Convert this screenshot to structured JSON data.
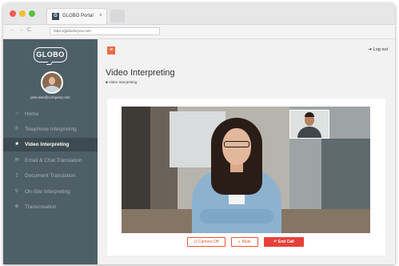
{
  "browser": {
    "tab_favicon": "G",
    "tab_title": "GLOBO Portal",
    "tab_close": "×",
    "nav_buttons": "← → C",
    "url": "https://globoforyou.com"
  },
  "sidebar": {
    "logo": "GLOBO",
    "user_email": "jane.doe@company.com",
    "items": [
      {
        "icon": "home-icon",
        "glyph": "⌂",
        "label": "Home"
      },
      {
        "icon": "phone-icon",
        "glyph": "✆",
        "label": "Telephone Interpreting"
      },
      {
        "icon": "video-camera-icon",
        "glyph": "■",
        "label": "Video Interpreting"
      },
      {
        "icon": "email-icon",
        "glyph": "✉",
        "label": "Email & Chat Translation"
      },
      {
        "icon": "document-icon",
        "glyph": "▯",
        "label": "Document Translation"
      },
      {
        "icon": "location-icon",
        "glyph": "⚲",
        "label": "On-Site Interpreting"
      },
      {
        "icon": "globe-icon",
        "glyph": "⊕",
        "label": "Transcreation"
      }
    ],
    "active_index": 2
  },
  "header": {
    "menu_glyph": "≡",
    "logout_label": "➜ Log out"
  },
  "main": {
    "page_title": "Video Interpreting",
    "breadcrumb": "■ Video Interpreting"
  },
  "controls": {
    "camera_label": "⊡ Camera Off",
    "mute_label": "◐ Mute",
    "end_label": "↶ End Call"
  },
  "colors": {
    "sidebar": "#4f5f67",
    "sidebar_active": "#3c4a51",
    "accent": "#ea6b44",
    "end_call": "#e6403a"
  }
}
